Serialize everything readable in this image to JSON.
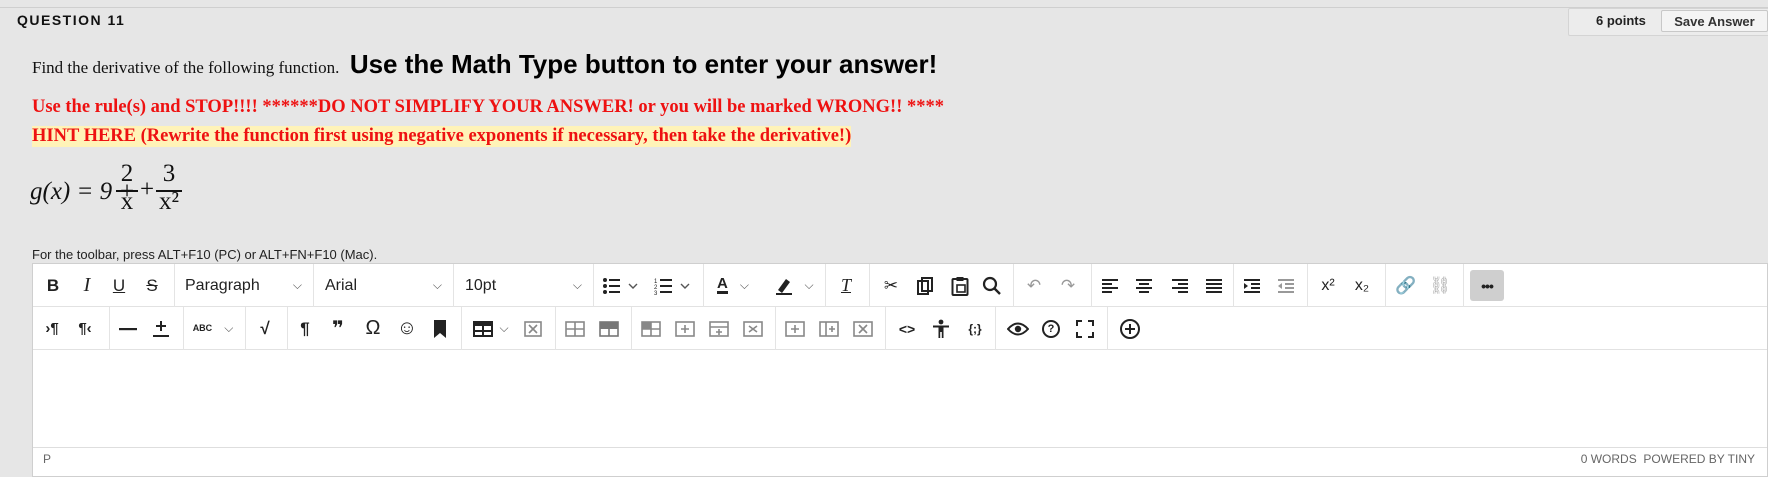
{
  "question": {
    "title": "QUESTION 11",
    "points": "6 points",
    "save_label": "Save Answer"
  },
  "instructions": {
    "prompt": "Find the derivative of the following function.",
    "emphasis": "Use the Math Type button to enter your answer!",
    "warning": "Use the rule(s) and STOP!!!!  ******DO NOT SIMPLIFY YOUR ANSWER! or you will be marked WRONG!! ****",
    "hint": "HINT HERE (Rewrite the function first using negative exponents if necessary, then take the derivative!)"
  },
  "formula": {
    "lhs": "g(x) = 9 +",
    "frac1_num": "2",
    "frac1_den": "x",
    "plus": "+",
    "frac2_num": "3",
    "frac2_den": "x²"
  },
  "toolbar_hint": "For the toolbar, press ALT+F10 (PC) or ALT+FN+F10 (Mac).",
  "editor": {
    "block_format": "Paragraph",
    "font_family": "Arial",
    "font_size": "10pt",
    "status_path": "P",
    "word_count": "0 WORDS",
    "powered_by": "POWERED BY TINY"
  },
  "colors": {
    "warning": "#ee1111",
    "hint_highlight": "#fff3b8",
    "page_bg": "#e6e6e6"
  },
  "icons": {
    "row1": [
      "bold-icon",
      "italic-icon",
      "underline-icon",
      "strikethrough-icon",
      "bullet-list-icon",
      "numbered-list-icon",
      "text-color-icon",
      "highlight-icon",
      "clear-formatting-icon",
      "cut-icon",
      "copy-icon",
      "paste-icon",
      "search-icon",
      "undo-icon",
      "redo-icon",
      "align-left-icon",
      "align-center-icon",
      "align-right-icon",
      "justify-icon",
      "indent-icon",
      "outdent-icon",
      "superscript-icon",
      "subscript-icon",
      "link-icon",
      "unlink-icon",
      "more-icon"
    ],
    "row2": [
      "ltr-icon",
      "rtl-icon",
      "horizontal-rule-icon",
      "insert-plus-minus-icon",
      "spellcheck-icon",
      "math-type-icon",
      "paragraph-mark-icon",
      "blockquote-icon",
      "omega-icon",
      "emoji-icon",
      "bookmark-icon",
      "table-icon",
      "delete-table-icon",
      "table-cell-icon",
      "table-row-icon",
      "table-col-icon",
      "insert-row-before-icon",
      "insert-row-after-icon",
      "delete-row-icon",
      "insert-col-before-icon",
      "insert-col-after-icon",
      "delete-col-icon",
      "code-icon",
      "accessibility-icon",
      "source-code-icon",
      "preview-icon",
      "help-icon",
      "fullscreen-icon",
      "add-content-icon"
    ]
  },
  "glyphs": {
    "bold": "B",
    "italic": "I",
    "underline": "U",
    "strike": "S",
    "clear": "T",
    "superscript": "x²",
    "subscript": "x₂",
    "more": "•••",
    "ltr": "¶",
    "rtl": "¶",
    "pilcrow": "¶",
    "quote": "❞",
    "omega": "Ω",
    "emoji": "☺",
    "code": "<>",
    "source": "{;}",
    "help": "?",
    "spellcheck": "ABC",
    "textcolor": "A"
  }
}
